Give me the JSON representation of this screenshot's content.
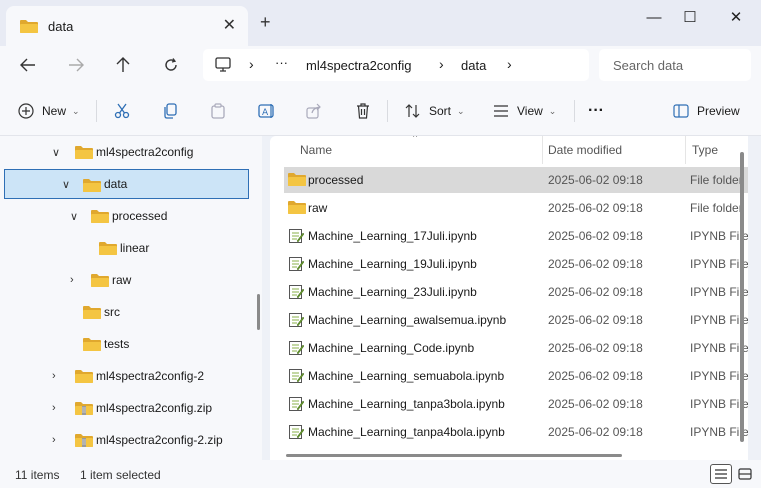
{
  "window": {
    "tab_title": "data",
    "new_tab": "+",
    "close_tab": "✕",
    "minimize": "—",
    "maximize": "☐",
    "close": "✕"
  },
  "address": {
    "ellipsis": "···",
    "crumbs": [
      "ml4spectra2config",
      "data"
    ],
    "search_placeholder": "Search data"
  },
  "toolbar": {
    "new_label": "New",
    "sort_label": "Sort",
    "view_label": "View",
    "more": "···",
    "preview_label": "Preview"
  },
  "tree": [
    {
      "label": "ml4spectra2config",
      "chevron": "∨",
      "icon": "folder-icon"
    },
    {
      "label": "data",
      "chevron": "∨",
      "icon": "folder-icon",
      "selected": true
    },
    {
      "label": "processed",
      "chevron": "∨",
      "icon": "folder-icon"
    },
    {
      "label": "linear",
      "chevron": "",
      "icon": "folder-icon"
    },
    {
      "label": "raw",
      "chevron": "›",
      "icon": "folder-icon"
    },
    {
      "label": "src",
      "chevron": "",
      "icon": "folder-icon"
    },
    {
      "label": "tests",
      "chevron": "",
      "icon": "folder-icon"
    },
    {
      "label": "ml4spectra2config-2",
      "chevron": "›",
      "icon": "folder-icon"
    },
    {
      "label": "ml4spectra2config.zip",
      "chevron": "›",
      "icon": "zip-folder-icon"
    },
    {
      "label": "ml4spectra2config-2.zip",
      "chevron": "›",
      "icon": "zip-folder-icon"
    }
  ],
  "columns": {
    "name": "Name",
    "date": "Date modified",
    "type": "Type"
  },
  "files": [
    {
      "name": "processed",
      "date": "2025-06-02 09:18",
      "type": "File folder",
      "icon": "folder-icon",
      "selected": true
    },
    {
      "name": "raw",
      "date": "2025-06-02 09:18",
      "type": "File folder",
      "icon": "folder-icon"
    },
    {
      "name": "Machine_Learning_17Juli.ipynb",
      "date": "2025-06-02 09:18",
      "type": "IPYNB File",
      "icon": "notebook-file-icon"
    },
    {
      "name": "Machine_Learning_19Juli.ipynb",
      "date": "2025-06-02 09:18",
      "type": "IPYNB File",
      "icon": "notebook-file-icon"
    },
    {
      "name": "Machine_Learning_23Juli.ipynb",
      "date": "2025-06-02 09:18",
      "type": "IPYNB File",
      "icon": "notebook-file-icon"
    },
    {
      "name": "Machine_Learning_awalsemua.ipynb",
      "date": "2025-06-02 09:18",
      "type": "IPYNB File",
      "icon": "notebook-file-icon"
    },
    {
      "name": "Machine_Learning_Code.ipynb",
      "date": "2025-06-02 09:18",
      "type": "IPYNB File",
      "icon": "notebook-file-icon"
    },
    {
      "name": "Machine_Learning_semuabola.ipynb",
      "date": "2025-06-02 09:18",
      "type": "IPYNB File",
      "icon": "notebook-file-icon"
    },
    {
      "name": "Machine_Learning_tanpa3bola.ipynb",
      "date": "2025-06-02 09:18",
      "type": "IPYNB File",
      "icon": "notebook-file-icon"
    },
    {
      "name": "Machine_Learning_tanpa4bola.ipynb",
      "date": "2025-06-02 09:18",
      "type": "IPYNB File",
      "icon": "notebook-file-icon"
    }
  ],
  "status": {
    "item_count": "11 items",
    "selection": "1 item selected"
  },
  "colors": {
    "folder": "#f4c542",
    "folder_dark": "#e0a82e",
    "selection_tree": "#cce4f7",
    "selection_border": "#2f6fb5",
    "selection_list": "#d9d9d9",
    "accent": "#0a64c8"
  }
}
